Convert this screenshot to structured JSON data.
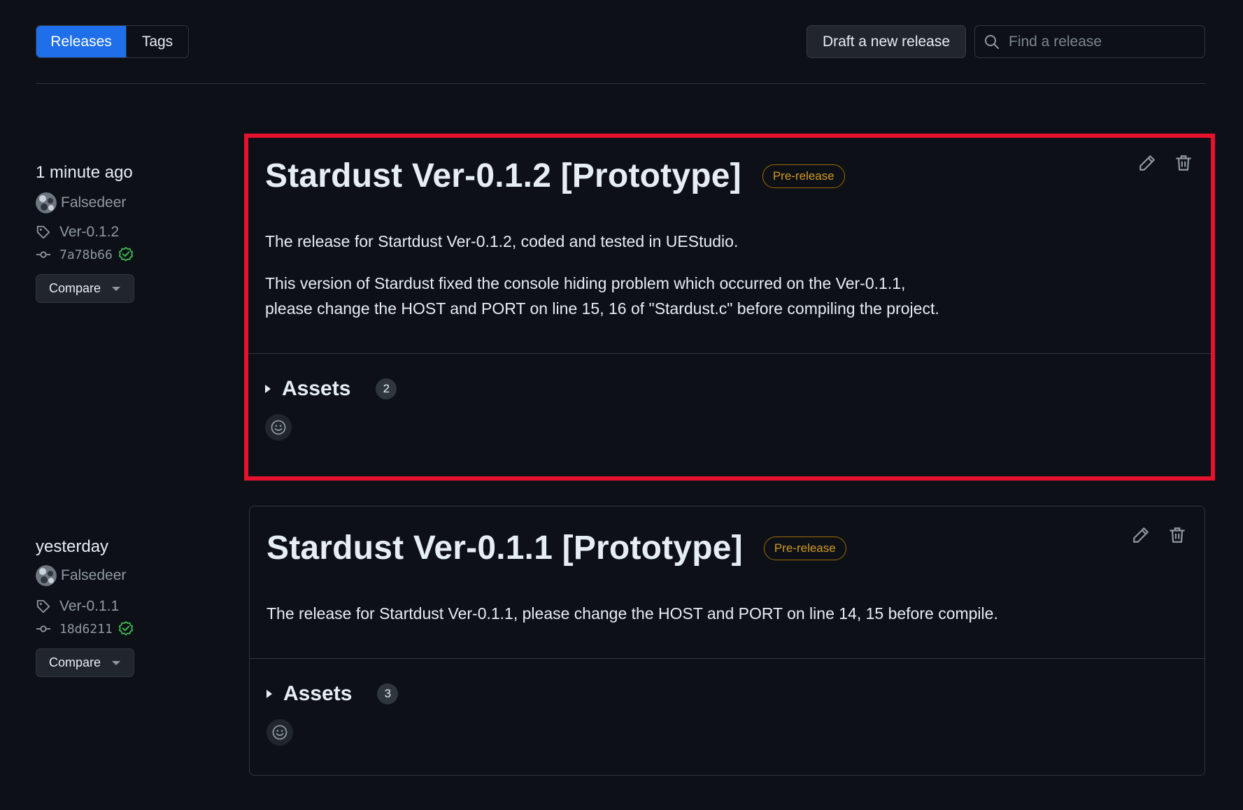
{
  "nav": {
    "tabs": [
      {
        "label": "Releases",
        "active": true
      },
      {
        "label": "Tags",
        "active": false
      }
    ],
    "draft_button": "Draft a new release",
    "search_placeholder": "Find a release"
  },
  "releases": [
    {
      "time": "1 minute ago",
      "author": "Falsedeer",
      "tag": "Ver-0.1.2",
      "commit": "7a78b66",
      "compare_label": "Compare",
      "title": "Stardust Ver-0.1.2 [Prototype]",
      "badge": "Pre-release",
      "body": [
        "The release for Startdust Ver-0.1.2, coded and tested in UEStudio.",
        "This version of Stardust fixed the console hiding problem which occurred on the Ver-0.1.1,",
        "please change the HOST and PORT on line 15, 16 of \"Stardust.c\" before compiling the project."
      ],
      "assets_label": "Assets",
      "assets_count": "2",
      "highlighted": true
    },
    {
      "time": "yesterday",
      "author": "Falsedeer",
      "tag": "Ver-0.1.1",
      "commit": "18d6211",
      "compare_label": "Compare",
      "title": "Stardust Ver-0.1.1 [Prototype]",
      "badge": "Pre-release",
      "body": [
        "The release for Startdust Ver-0.1.1, please change the HOST and PORT on line 14, 15 before compile."
      ],
      "assets_label": "Assets",
      "assets_count": "3",
      "highlighted": false
    }
  ],
  "colors": {
    "background": "#0d1117",
    "accent": "#1f6feb",
    "highlight_frame": "#e8112d",
    "badge": "#d29922",
    "verified": "#3fb950"
  },
  "icons": [
    "search-icon",
    "tag-icon",
    "commit-icon",
    "verified-check-icon",
    "pencil-icon",
    "trash-icon",
    "smiley-icon",
    "caret-down-icon"
  ]
}
